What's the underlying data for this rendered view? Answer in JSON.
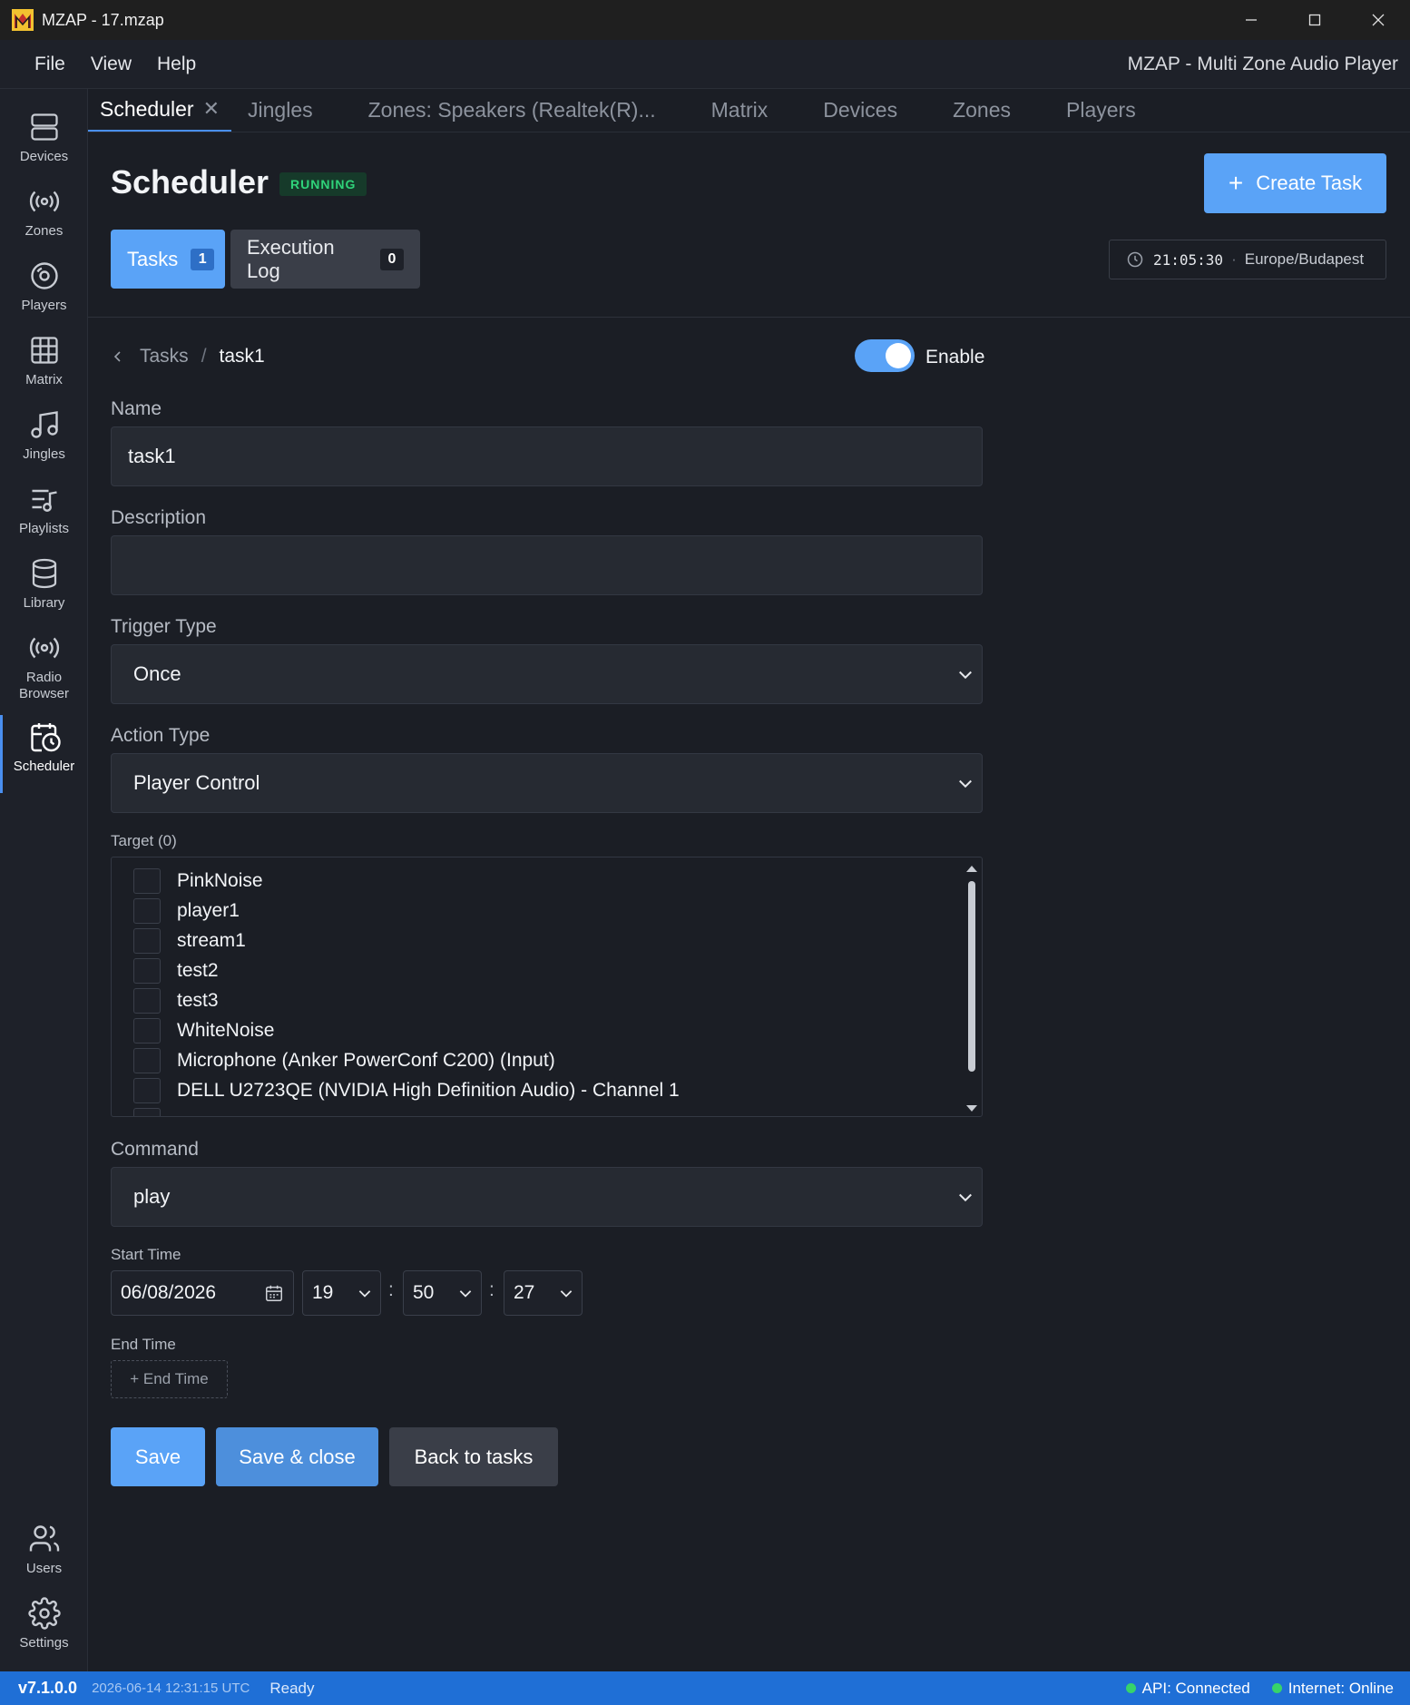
{
  "window": {
    "title": "MZAP - 17.mzap",
    "icons": [
      "app-logo-icon",
      "minimize-icon",
      "maximize-icon",
      "close-icon"
    ]
  },
  "menu": {
    "items": [
      "File",
      "View",
      "Help"
    ],
    "app_title": "MZAP - Multi Zone Audio Player"
  },
  "sidebar": {
    "items": [
      {
        "label": "Devices",
        "icon": "server-icon"
      },
      {
        "label": "Zones",
        "icon": "broadcast-icon"
      },
      {
        "label": "Players",
        "icon": "disc-icon"
      },
      {
        "label": "Matrix",
        "icon": "grid-icon"
      },
      {
        "label": "Jingles",
        "icon": "music-note-icon"
      },
      {
        "label": "Playlists",
        "icon": "playlist-icon"
      },
      {
        "label": "Library",
        "icon": "database-icon"
      },
      {
        "label": "Radio",
        "label2": "Browser",
        "icon": "radio-icon"
      },
      {
        "label": "Scheduler",
        "icon": "calendar-clock-icon"
      }
    ],
    "bottom": [
      {
        "label": "Users",
        "icon": "users-icon"
      },
      {
        "label": "Settings",
        "icon": "gear-icon"
      }
    ]
  },
  "tabs": [
    "Scheduler",
    "Jingles",
    "Zones: Speakers (Realtek(R)...",
    "Matrix",
    "Devices",
    "Zones",
    "Players"
  ],
  "header": {
    "title": "Scheduler",
    "status": "RUNNING",
    "create_label": "Create Task",
    "subtabs": [
      {
        "label": "Tasks",
        "count": "1"
      },
      {
        "label": "Execution Log",
        "count": "0"
      }
    ],
    "clock_time": "21:05:30",
    "clock_sep": "·",
    "timezone": "Europe/Budapest"
  },
  "breadcrumb": {
    "parent": "Tasks",
    "sep": "/",
    "current": "task1"
  },
  "enable": {
    "label": "Enable",
    "on": true
  },
  "form": {
    "name_label": "Name",
    "name_value": "task1",
    "description_label": "Description",
    "description_value": "",
    "trigger_label": "Trigger Type",
    "trigger_value": "Once",
    "action_label": "Action Type",
    "action_value": "Player Control",
    "target_label": "Target (0)",
    "targets": [
      "PinkNoise",
      "player1",
      "stream1",
      "test2",
      "test3",
      "WhiteNoise",
      "Microphone (Anker PowerConf C200) (Input)",
      "DELL U2723QE (NVIDIA High Definition Audio) - Channel 1"
    ],
    "command_label": "Command",
    "command_value": "play",
    "start_label": "Start Time",
    "start_date": "06/08/2026",
    "start_hour": "19",
    "start_minute": "50",
    "start_second": "27",
    "time_colon": ":",
    "end_label": "End Time",
    "end_button": "+ End Time"
  },
  "actions": {
    "save": "Save",
    "save_close": "Save & close",
    "back": "Back to tasks"
  },
  "status_bar": {
    "version": "v7.1.0.0",
    "timestamp": "2026-06-14 12:31:15 UTC",
    "state": "Ready",
    "api": "API: Connected",
    "internet": "Internet: Online"
  },
  "colors": {
    "accent": "#5aa3f7",
    "status_bar": "#1f6fd6",
    "running": "#2fd37a"
  }
}
